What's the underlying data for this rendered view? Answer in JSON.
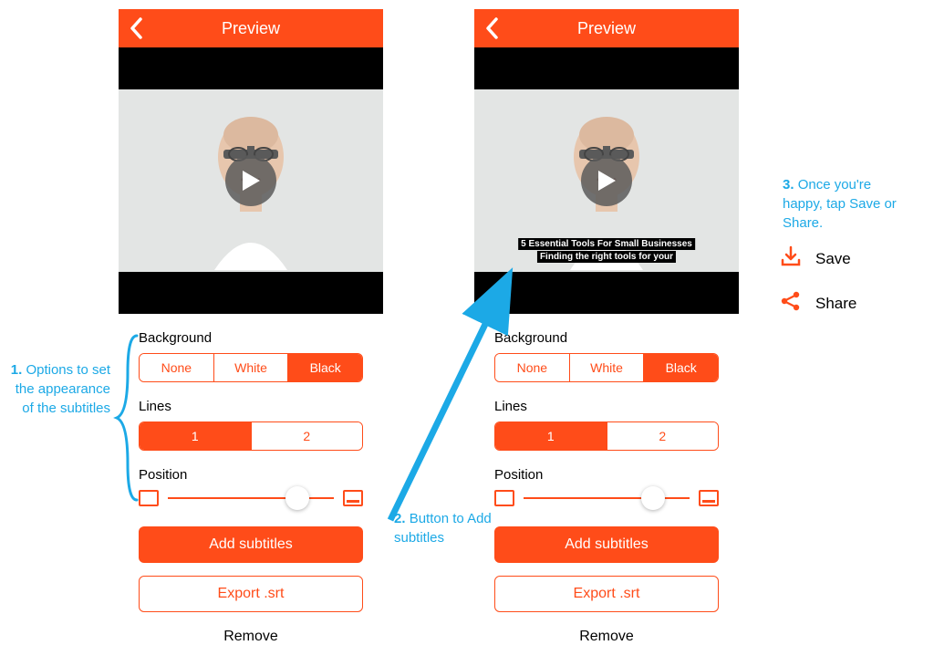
{
  "navbar": {
    "title": "Preview"
  },
  "controls": {
    "background": {
      "label": "Background",
      "options": [
        "None",
        "White",
        "Black"
      ],
      "selected": "Black"
    },
    "lines": {
      "label": "Lines",
      "options": [
        "1",
        "2"
      ],
      "selected": "1"
    },
    "position": {
      "label": "Position",
      "value": 0.78
    },
    "add_subtitles": "Add subtitles",
    "export_srt": "Export .srt",
    "remove": "Remove"
  },
  "subtitles_preview": {
    "line1": "5 Essential Tools For Small Businesses",
    "line2": "Finding the right tools for your"
  },
  "annotations": {
    "a1_num": "1.",
    "a1_text": "Options to set the appearance of the subtitles",
    "a2_num": "2.",
    "a2_text": "Button to Add subtitles",
    "a3_num": "3.",
    "a3_text": "Once you're happy, tap Save or Share."
  },
  "actions": {
    "save": "Save",
    "share": "Share"
  }
}
